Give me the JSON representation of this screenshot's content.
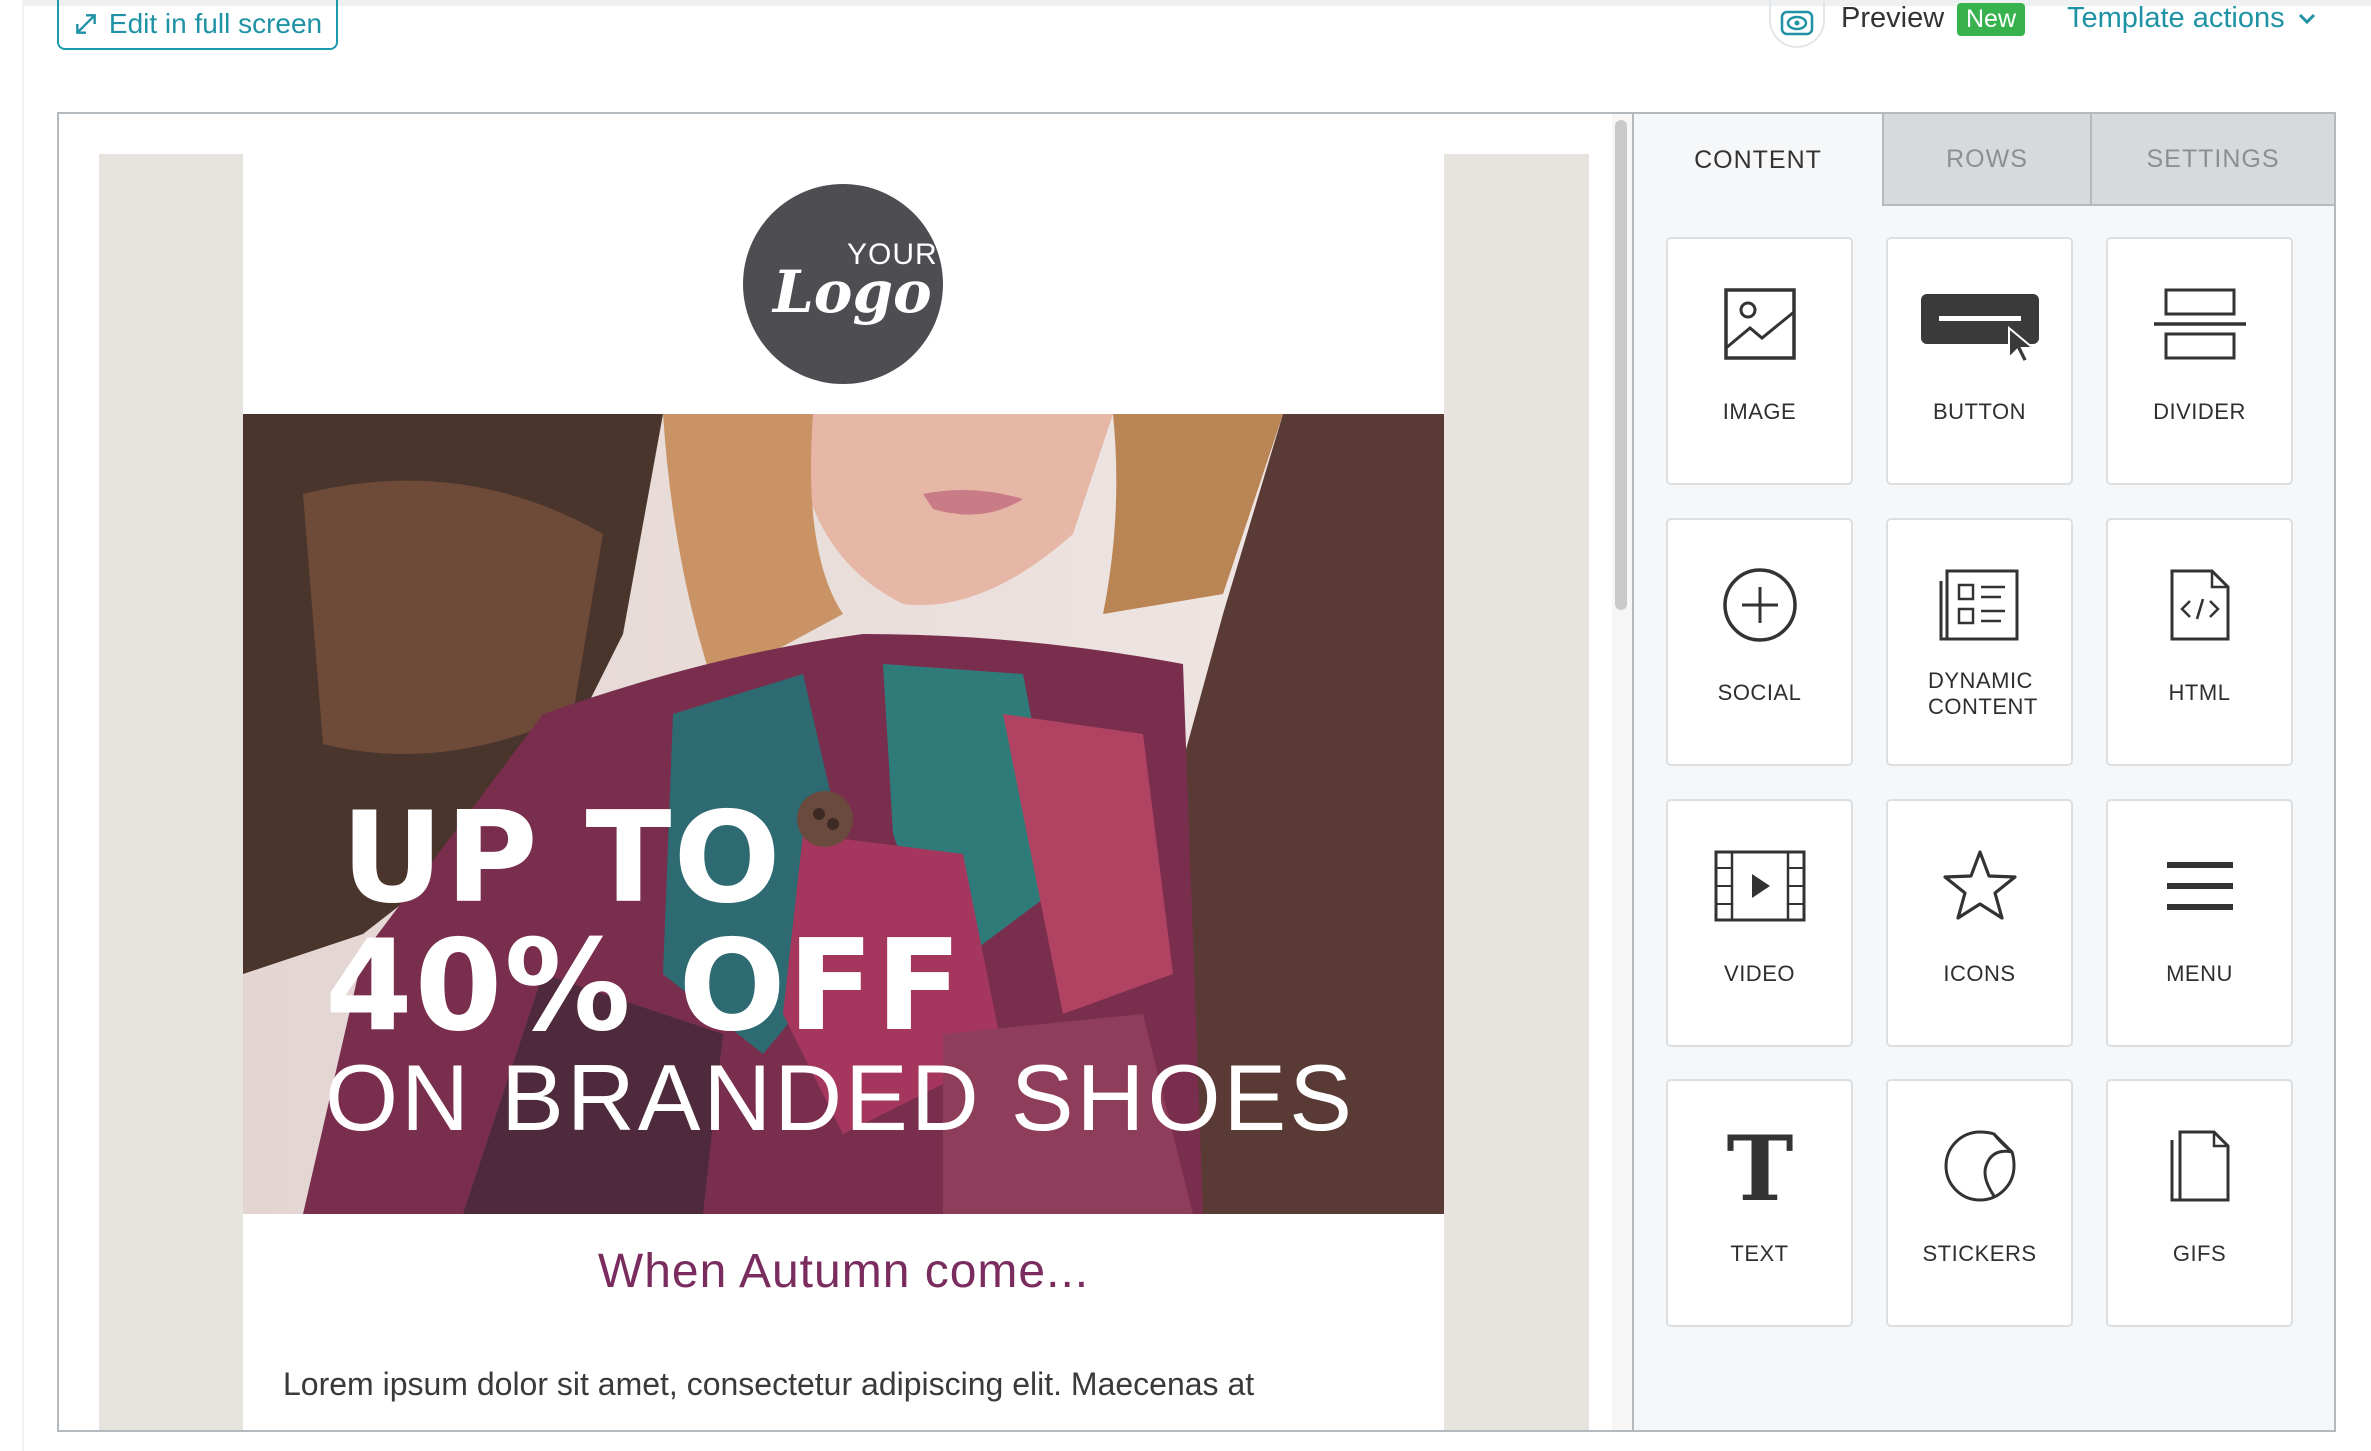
{
  "topbar": {
    "edit_fullscreen_label": "Edit in full screen",
    "preview_label": "Preview",
    "new_badge": "New",
    "template_actions_label": "Template actions"
  },
  "email": {
    "logo_your": "YOUR",
    "logo_script": "Logo",
    "hero_line1": "UP TO",
    "hero_line2": "40% OFF",
    "hero_line3": "ON BRANDED SHOES",
    "section_title": "When Autumn come...",
    "body_text": "Lorem ipsum dolor sit amet, consectetur adipiscing elit. Maecenas at"
  },
  "panel": {
    "tabs": [
      {
        "label": "CONTENT",
        "active": true
      },
      {
        "label": "ROWS",
        "active": false
      },
      {
        "label": "SETTINGS",
        "active": false
      }
    ],
    "blocks": [
      {
        "label": "IMAGE",
        "icon": "image-icon"
      },
      {
        "label": "BUTTON",
        "icon": "button-icon"
      },
      {
        "label": "DIVIDER",
        "icon": "divider-icon"
      },
      {
        "label": "SOCIAL",
        "icon": "social-icon"
      },
      {
        "label": "DYNAMIC CONTENT",
        "icon": "dynamic-content-icon"
      },
      {
        "label": "HTML",
        "icon": "html-icon"
      },
      {
        "label": "VIDEO",
        "icon": "video-icon"
      },
      {
        "label": "ICONS",
        "icon": "star-icon"
      },
      {
        "label": "MENU",
        "icon": "menu-icon"
      },
      {
        "label": "TEXT",
        "icon": "text-icon"
      },
      {
        "label": "STICKERS",
        "icon": "sticker-icon"
      },
      {
        "label": "GIFS",
        "icon": "gif-file-icon"
      }
    ]
  },
  "colors": {
    "accent": "#1f92a6",
    "new_badge": "#37b24d",
    "title_purple": "#7b2c5f",
    "logo_bg": "#4e4e52"
  }
}
